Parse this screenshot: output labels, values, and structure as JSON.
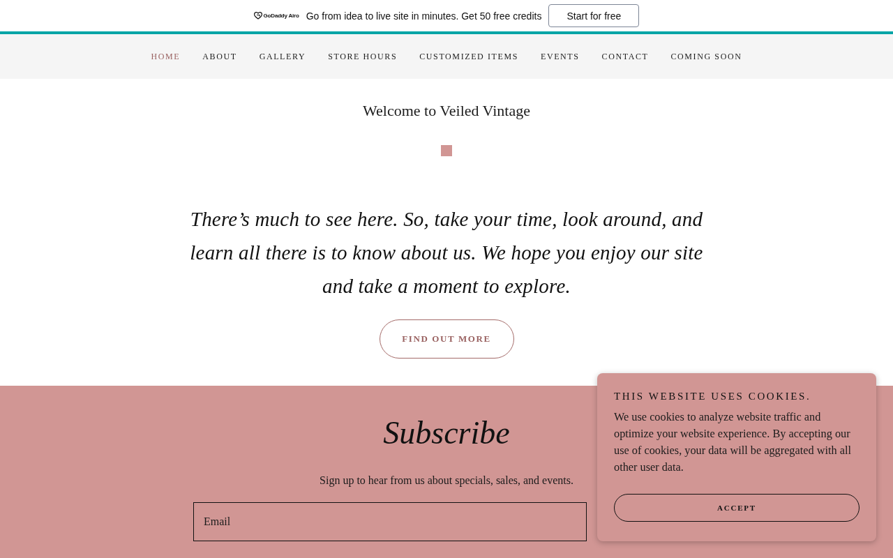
{
  "promo_banner": {
    "logo_text": "GoDaddy Airo",
    "message": "Go from idea to live site in minutes. Get 50 free credits",
    "button": "Start for free"
  },
  "nav": {
    "items": [
      {
        "label": "HOME",
        "selected": true
      },
      {
        "label": "ABOUT",
        "selected": false
      },
      {
        "label": "GALLERY",
        "selected": false
      },
      {
        "label": "STORE HOURS",
        "selected": false
      },
      {
        "label": "CUSTOMIZED ITEMS",
        "selected": false
      },
      {
        "label": "EVENTS",
        "selected": false
      },
      {
        "label": "CONTACT",
        "selected": false
      },
      {
        "label": "COMING SOON",
        "selected": false
      }
    ]
  },
  "hero": {
    "title": "Welcome to Veiled Vintage",
    "quote": "There’s much to see here. So, take your time, look around, and learn all there is to know about us. We hope you enjoy our site and take a moment to explore.",
    "button": "FIND OUT MORE"
  },
  "subscribe": {
    "title": "Subscribe",
    "text": "Sign up to hear from us about specials, sales, and events.",
    "email_field": {
      "placeholder": "Email"
    }
  },
  "cookie_banner": {
    "title": "THIS WEBSITE USES COOKIES.",
    "text": "We use cookies to analyze website traffic and optimize your website experience. By accepting our use of cookies, your data will be aggregated with all other user data.",
    "button": "ACCEPT"
  }
}
